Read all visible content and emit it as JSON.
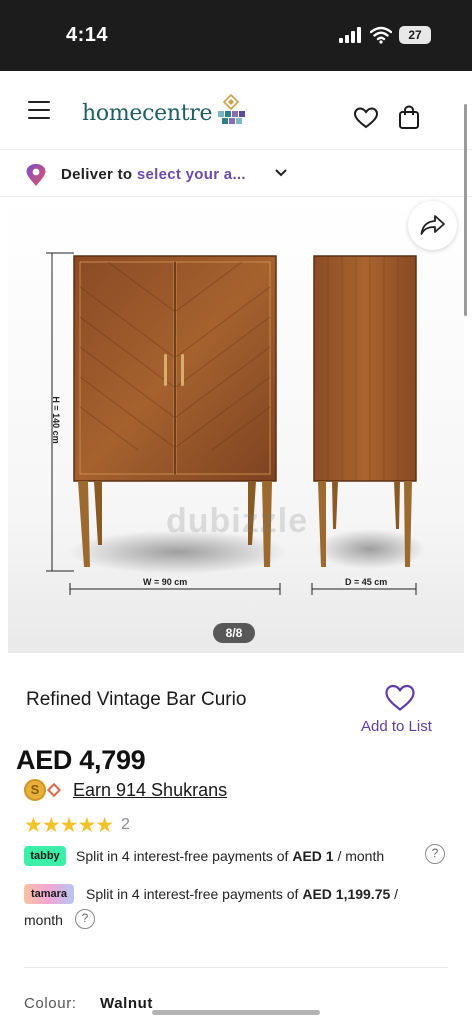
{
  "status_bar": {
    "time": "4:14",
    "battery": "27"
  },
  "header": {
    "logo_text": "homecentre",
    "brand_color": "#1f5f63",
    "icons": [
      "menu-icon",
      "heart-icon",
      "shopping-bag-icon"
    ]
  },
  "deliver": {
    "prefix": "Deliver to",
    "link": "select your a...",
    "link_color": "#6b4ca8"
  },
  "gallery": {
    "height_label": "H = 140 cm",
    "width_label": "W = 90 cm",
    "depth_label": "D = 45 cm",
    "watermark": "dubizzle",
    "counter": "8/8"
  },
  "product": {
    "title": "Refined Vintage Bar Curio",
    "add_to_list": "Add to List",
    "price": "AED 4,799",
    "shukran_symbol": "S",
    "shukran_text": "Earn 914 Shukrans",
    "rating_stars": 5,
    "stars_display": "★★★★★",
    "rating_count": "2",
    "accent_color": "#5f3ea4"
  },
  "payments": {
    "tabby": {
      "badge": "tabby",
      "text_before": "Split in 4 interest-free payments of ",
      "amount": "AED 1",
      "text_after": " / month",
      "info": "?"
    },
    "tamara": {
      "badge": "tamara",
      "text_before": "Split in 4 interest-free payments of ",
      "amount": "AED 1,199.75",
      "text_after": " /",
      "line2": "month",
      "info": "?"
    }
  },
  "attributes": {
    "colour_label": "Colour:",
    "colour_value": "Walnut"
  }
}
